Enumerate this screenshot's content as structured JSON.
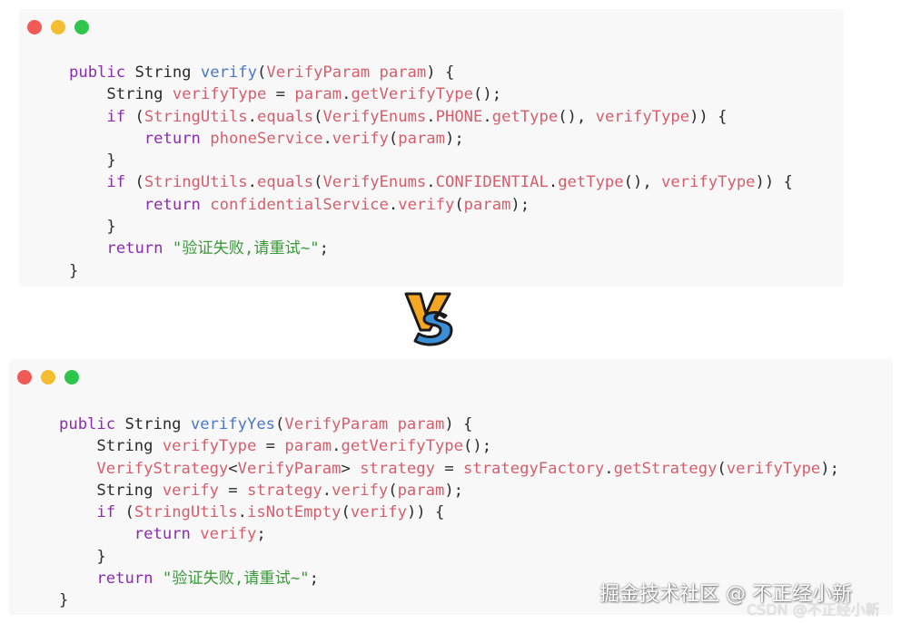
{
  "code_before": {
    "lines": [
      [
        {
          "t": "public",
          "c": "kw"
        },
        {
          "t": " String ",
          "c": "pl"
        },
        {
          "t": "verify",
          "c": "fn"
        },
        {
          "t": "(",
          "c": "pl"
        },
        {
          "t": "VerifyParam param",
          "c": "var"
        },
        {
          "t": ") {",
          "c": "pl"
        }
      ],
      [
        {
          "t": "    String ",
          "c": "pl"
        },
        {
          "t": "verifyType",
          "c": "var"
        },
        {
          "t": " = ",
          "c": "pl"
        },
        {
          "t": "param",
          "c": "var"
        },
        {
          "t": ".",
          "c": "pl"
        },
        {
          "t": "getVerifyType",
          "c": "var"
        },
        {
          "t": "();",
          "c": "pl"
        }
      ],
      [
        {
          "t": "    ",
          "c": "pl"
        },
        {
          "t": "if",
          "c": "kw"
        },
        {
          "t": " (",
          "c": "pl"
        },
        {
          "t": "StringUtils",
          "c": "var"
        },
        {
          "t": ".",
          "c": "pl"
        },
        {
          "t": "equals",
          "c": "var"
        },
        {
          "t": "(",
          "c": "pl"
        },
        {
          "t": "VerifyEnums",
          "c": "var"
        },
        {
          "t": ".",
          "c": "pl"
        },
        {
          "t": "PHONE",
          "c": "var"
        },
        {
          "t": ".",
          "c": "pl"
        },
        {
          "t": "getType",
          "c": "var"
        },
        {
          "t": "(), ",
          "c": "pl"
        },
        {
          "t": "verifyType",
          "c": "var"
        },
        {
          "t": ")) {",
          "c": "pl"
        }
      ],
      [
        {
          "t": "        ",
          "c": "pl"
        },
        {
          "t": "return",
          "c": "kw"
        },
        {
          "t": " ",
          "c": "pl"
        },
        {
          "t": "phoneService",
          "c": "var"
        },
        {
          "t": ".",
          "c": "pl"
        },
        {
          "t": "verify",
          "c": "var"
        },
        {
          "t": "(",
          "c": "pl"
        },
        {
          "t": "param",
          "c": "var"
        },
        {
          "t": ");",
          "c": "pl"
        }
      ],
      [
        {
          "t": "    }",
          "c": "pl"
        }
      ],
      [
        {
          "t": "    ",
          "c": "pl"
        },
        {
          "t": "if",
          "c": "kw"
        },
        {
          "t": " (",
          "c": "pl"
        },
        {
          "t": "StringUtils",
          "c": "var"
        },
        {
          "t": ".",
          "c": "pl"
        },
        {
          "t": "equals",
          "c": "var"
        },
        {
          "t": "(",
          "c": "pl"
        },
        {
          "t": "VerifyEnums",
          "c": "var"
        },
        {
          "t": ".",
          "c": "pl"
        },
        {
          "t": "CONFIDENTIAL",
          "c": "var"
        },
        {
          "t": ".",
          "c": "pl"
        },
        {
          "t": "getType",
          "c": "var"
        },
        {
          "t": "(), ",
          "c": "pl"
        },
        {
          "t": "verifyType",
          "c": "var"
        },
        {
          "t": ")) {",
          "c": "pl"
        }
      ],
      [
        {
          "t": "        ",
          "c": "pl"
        },
        {
          "t": "return",
          "c": "kw"
        },
        {
          "t": " ",
          "c": "pl"
        },
        {
          "t": "confidentialService",
          "c": "var"
        },
        {
          "t": ".",
          "c": "pl"
        },
        {
          "t": "verify",
          "c": "var"
        },
        {
          "t": "(",
          "c": "pl"
        },
        {
          "t": "param",
          "c": "var"
        },
        {
          "t": ");",
          "c": "pl"
        }
      ],
      [
        {
          "t": "    }",
          "c": "pl"
        }
      ],
      [
        {
          "t": "    ",
          "c": "pl"
        },
        {
          "t": "return",
          "c": "kw"
        },
        {
          "t": " ",
          "c": "pl"
        },
        {
          "t": "\"验证失败,请重试~\"",
          "c": "str"
        },
        {
          "t": ";",
          "c": "pl"
        }
      ],
      [
        {
          "t": "}",
          "c": "pl"
        }
      ]
    ]
  },
  "code_after": {
    "lines": [
      [
        {
          "t": "public",
          "c": "kw"
        },
        {
          "t": " String ",
          "c": "pl"
        },
        {
          "t": "verifyYes",
          "c": "fn"
        },
        {
          "t": "(",
          "c": "pl"
        },
        {
          "t": "VerifyParam param",
          "c": "var"
        },
        {
          "t": ") {",
          "c": "pl"
        }
      ],
      [
        {
          "t": "    String ",
          "c": "pl"
        },
        {
          "t": "verifyType",
          "c": "var"
        },
        {
          "t": " = ",
          "c": "pl"
        },
        {
          "t": "param",
          "c": "var"
        },
        {
          "t": ".",
          "c": "pl"
        },
        {
          "t": "getVerifyType",
          "c": "var"
        },
        {
          "t": "();",
          "c": "pl"
        }
      ],
      [
        {
          "t": "    ",
          "c": "pl"
        },
        {
          "t": "VerifyStrategy",
          "c": "var"
        },
        {
          "t": "<",
          "c": "pl"
        },
        {
          "t": "VerifyParam",
          "c": "var"
        },
        {
          "t": "> ",
          "c": "pl"
        },
        {
          "t": "strategy",
          "c": "var"
        },
        {
          "t": " = ",
          "c": "pl"
        },
        {
          "t": "strategyFactory",
          "c": "var"
        },
        {
          "t": ".",
          "c": "pl"
        },
        {
          "t": "getStrategy",
          "c": "var"
        },
        {
          "t": "(",
          "c": "pl"
        },
        {
          "t": "verifyType",
          "c": "var"
        },
        {
          "t": ");",
          "c": "pl"
        }
      ],
      [
        {
          "t": "    String ",
          "c": "pl"
        },
        {
          "t": "verify",
          "c": "var"
        },
        {
          "t": " = ",
          "c": "pl"
        },
        {
          "t": "strategy",
          "c": "var"
        },
        {
          "t": ".",
          "c": "pl"
        },
        {
          "t": "verify",
          "c": "var"
        },
        {
          "t": "(",
          "c": "pl"
        },
        {
          "t": "param",
          "c": "var"
        },
        {
          "t": ");",
          "c": "pl"
        }
      ],
      [
        {
          "t": "    ",
          "c": "pl"
        },
        {
          "t": "if",
          "c": "kw"
        },
        {
          "t": " (",
          "c": "pl"
        },
        {
          "t": "StringUtils",
          "c": "var"
        },
        {
          "t": ".",
          "c": "pl"
        },
        {
          "t": "isNotEmpty",
          "c": "var"
        },
        {
          "t": "(",
          "c": "pl"
        },
        {
          "t": "verify",
          "c": "var"
        },
        {
          "t": ")) {",
          "c": "pl"
        }
      ],
      [
        {
          "t": "        ",
          "c": "pl"
        },
        {
          "t": "return",
          "c": "kw"
        },
        {
          "t": " ",
          "c": "pl"
        },
        {
          "t": "verify",
          "c": "var"
        },
        {
          "t": ";",
          "c": "pl"
        }
      ],
      [
        {
          "t": "    }",
          "c": "pl"
        }
      ],
      [
        {
          "t": "    ",
          "c": "pl"
        },
        {
          "t": "return",
          "c": "kw"
        },
        {
          "t": " ",
          "c": "pl"
        },
        {
          "t": "\"验证失败,请重试~\"",
          "c": "str"
        },
        {
          "t": ";",
          "c": "pl"
        }
      ],
      [
        {
          "t": "}",
          "c": "pl"
        }
      ]
    ]
  },
  "vs_badge": {
    "icon": "vs-icon",
    "colors": {
      "v": "#f5a623",
      "s": "#3b8fd6",
      "outline": "#1a1a1a"
    }
  },
  "watermark": {
    "main": "掘金技术社区 @ 不正经小新",
    "csdn": "CSDN @不正经小新"
  },
  "window_dots": {
    "red": "#f25a57",
    "yellow": "#f5be30",
    "green": "#2ec54a"
  },
  "syntax_colors": {
    "keyword": "#8c2bb0",
    "function": "#4a77c9",
    "identifier": "#d45f6c",
    "string": "#3a9a3a",
    "plain": "#2b2b2b"
  }
}
